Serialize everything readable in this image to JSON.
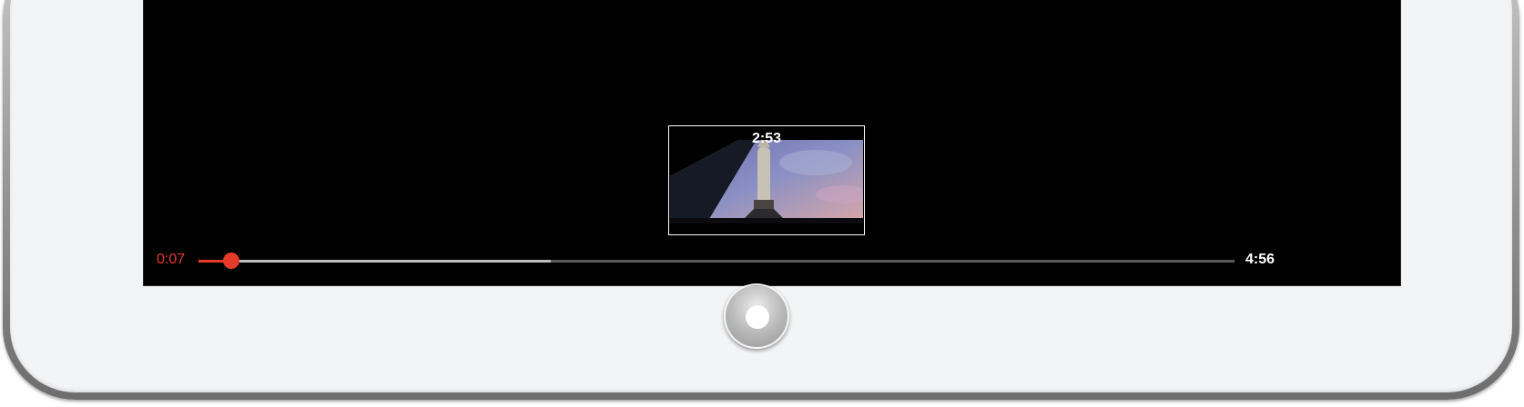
{
  "player": {
    "current_time": "0:07",
    "total_time": "4:56",
    "played_fraction": 0.032,
    "buffered_fraction": 0.34
  },
  "preview": {
    "time": "2:53",
    "thumbnail_icon": "rocket-launch-thumbnail"
  },
  "colors": {
    "accent": "#e63a2a",
    "screen": "#000000",
    "bezel": "#f3f4f6"
  }
}
